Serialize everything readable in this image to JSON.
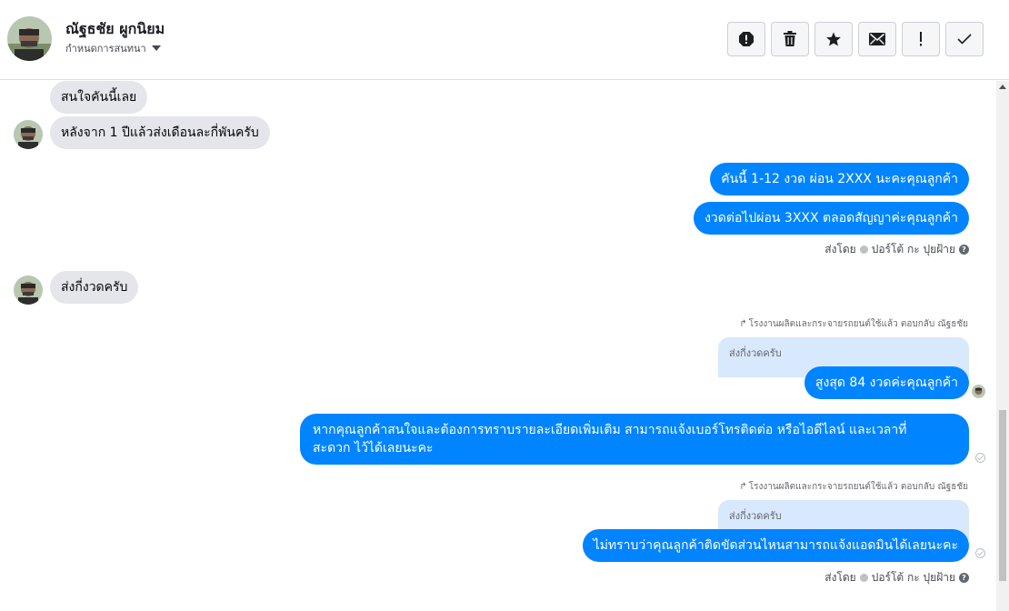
{
  "header": {
    "name": "ณัฐธชัย ผูกนิยม",
    "subtitle": "กำหนดการสนทนา",
    "actions": [
      "spam-report",
      "delete",
      "star",
      "mark-unread",
      "important",
      "done"
    ]
  },
  "messages": {
    "m1": "สนใจคันนี้เลย",
    "m2": "หลังจาก 1 ปีแล้วส่งเดือนละกี่พันครับ",
    "m3": "คันนี้ 1-12 งวด ผ่อน 2XXX นะคะคุณลูกค้า",
    "m4": "งวดต่อไปผ่อน 3XXX  ตลอดสัญญาค่ะคุณลูกค้า",
    "m5": "ส่งกี่งวดครับ",
    "m6": "สูงสุด 84 งวดค่ะคุณลูกค้า",
    "m7_line1": "หากคุณลูกค้าสนใจและต้องการทราบรายละเอียดเพิ่มเติม สามารถแจ้งเบอร์โทรติดต่อ หรือไอดีไลน์ และเวลาที่",
    "m7_line2": "สะดวก ไว้ได้เลยนะคะ",
    "m8": "ไม่ทราบว่าคุณลูกค้าติดขัดส่วนไหนสามารถแจ้งแอดมินได้เลยนะคะ"
  },
  "meta": {
    "sent_by_label": "ส่งโดย",
    "sender_name": "ปอร์โต้ กะ ปุยฝ้าย",
    "reply_note": "โรงงานผลิตและกระจายรถยนต์ใช้แล้ว ตอบกลับ ณัฐธชัย",
    "quoted": "ส่งกี่งวดครับ"
  },
  "colors": {
    "outgoing": "#0084ff",
    "incoming": "#e4e6eb",
    "quote_bg": "#d8e8fd"
  }
}
